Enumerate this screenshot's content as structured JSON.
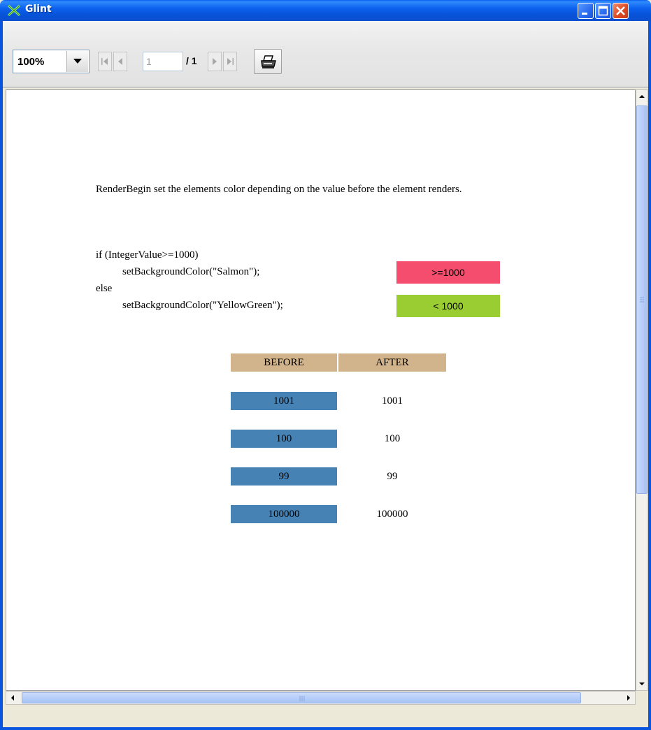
{
  "window": {
    "title": "Glint",
    "app_icon": "glint-logo-icon",
    "controls": [
      "minimize-icon",
      "maximize-icon",
      "close-icon"
    ]
  },
  "toolbar": {
    "zoom": {
      "selected": "100%"
    },
    "navigation": {
      "first_icon": "first-page-icon",
      "prev_icon": "previous-page-icon",
      "page_value": "1",
      "page_total": "/ 1",
      "next_icon": "next-page-icon",
      "last_icon": "last-page-icon"
    },
    "print_icon": "printer-icon"
  },
  "document": {
    "description": "RenderBegin set the elements color depending on the value before the element renders.",
    "code": {
      "line1": "if (IntegerValue>=1000)",
      "line2": "setBackgroundColor(\"Salmon\");",
      "line3": "else",
      "line4": "setBackgroundColor(\"YellowGreen\");"
    },
    "legend": {
      "high_label": ">=1000",
      "high_color": "#f54d6e",
      "low_label": "< 1000",
      "low_color": "#9acd32"
    },
    "table": {
      "headers": {
        "before": "BEFORE",
        "after": "AFTER"
      },
      "header_color": "#d2b48c",
      "before_color": "#4682b4",
      "rows": [
        {
          "before": "1001",
          "after": "1001"
        },
        {
          "before": "100",
          "after": "100"
        },
        {
          "before": "99",
          "after": "99"
        },
        {
          "before": "100000",
          "after": "100000"
        }
      ]
    }
  },
  "scrollbars": {
    "vertical": {
      "up_icon": "scroll-up-arrow-icon",
      "down_icon": "scroll-down-arrow-icon"
    },
    "horizontal": {
      "left_icon": "scroll-left-arrow-icon",
      "right_icon": "scroll-right-arrow-icon"
    }
  }
}
